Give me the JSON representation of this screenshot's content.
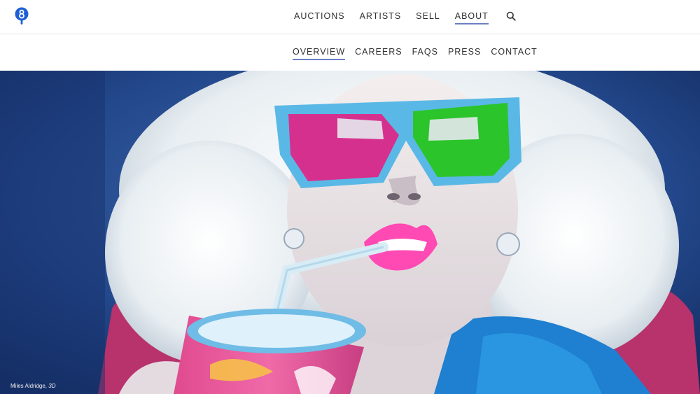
{
  "header": {
    "logo_icon": "bid-8-logo-icon",
    "nav": [
      {
        "label": "AUCTIONS",
        "active": false
      },
      {
        "label": "ARTISTS",
        "active": false
      },
      {
        "label": "SELL",
        "active": false
      },
      {
        "label": "ABOUT",
        "active": true
      }
    ],
    "search_icon": "search-icon"
  },
  "subnav": [
    {
      "label": "OVERVIEW",
      "active": true
    },
    {
      "label": "CAREERS",
      "active": false
    },
    {
      "label": "FAQS",
      "active": false
    },
    {
      "label": "PRESS",
      "active": false
    },
    {
      "label": "CONTACT",
      "active": false
    }
  ],
  "hero": {
    "caption_artist": "Miles Aldridge,",
    "caption_title": "3D"
  },
  "colors": {
    "accent": "#6b7fc4",
    "logo_blue": "#1f5fd6",
    "hero_background": "#1a3a78"
  }
}
